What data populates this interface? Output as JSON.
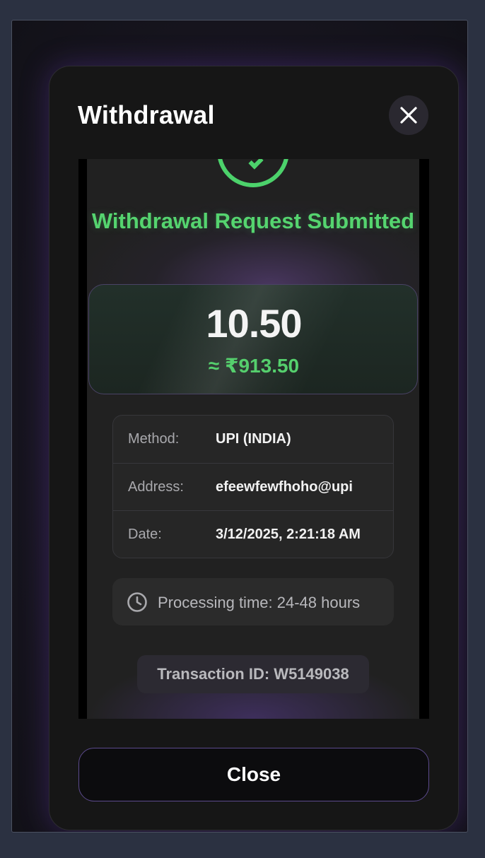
{
  "modal": {
    "title": "Withdrawal",
    "close_icon": "close-icon"
  },
  "receipt": {
    "status_icon": "check-circle-icon",
    "status_title": "Withdrawal Request Submitted",
    "amount": "10.50",
    "fiat_amount": "≈ ₹913.50",
    "details": [
      {
        "label": "Method:",
        "value": "UPI (INDIA)"
      },
      {
        "label": "Address:",
        "value": "efeewfewfhoho@upi"
      },
      {
        "label": "Date:",
        "value": "3/12/2025, 2:21:18 AM"
      }
    ],
    "processing_icon": "clock-icon",
    "processing_text": "Processing time: 24-48 hours",
    "transaction_id": "Transaction ID: W5149038"
  },
  "footer": {
    "close_label": "Close"
  },
  "colors": {
    "accent_green": "#55d46f",
    "accent_purple": "#5b4a8c",
    "modal_bg": "#161616",
    "page_bg": "#2b3141"
  }
}
